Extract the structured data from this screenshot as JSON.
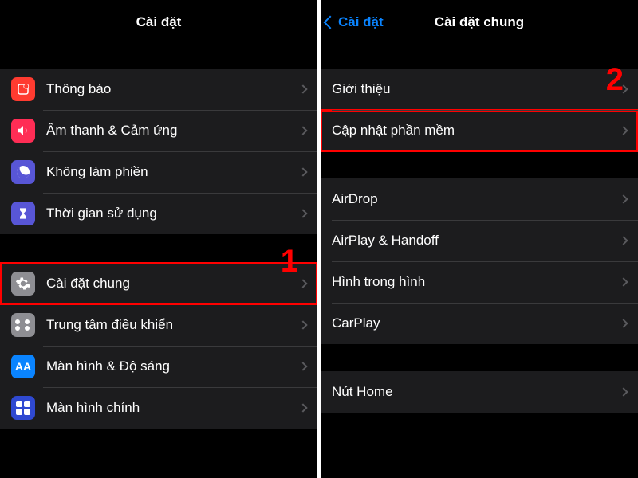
{
  "left": {
    "title": "Cài đặt",
    "step_number": "1",
    "sections": [
      {
        "rows": [
          {
            "icon": "notif",
            "label": "Thông báo"
          },
          {
            "icon": "sound",
            "label": "Âm thanh & Cảm ứng"
          },
          {
            "icon": "dnd",
            "label": "Không làm phiền"
          },
          {
            "icon": "time",
            "label": "Thời gian sử dụng"
          }
        ]
      },
      {
        "rows": [
          {
            "icon": "general",
            "label": "Cài đặt chung",
            "highlight": true
          },
          {
            "icon": "control",
            "label": "Trung tâm điều khiển"
          },
          {
            "icon": "display",
            "label": "Màn hình & Độ sáng"
          },
          {
            "icon": "home",
            "label": "Màn hình chính"
          }
        ]
      }
    ]
  },
  "right": {
    "back_label": "Cài đặt",
    "title": "Cài đặt chung",
    "step_number": "2",
    "sections": [
      {
        "rows": [
          {
            "label": "Giới thiệu"
          },
          {
            "label": "Cập nhật phần mềm",
            "highlight": true
          }
        ]
      },
      {
        "rows": [
          {
            "label": "AirDrop"
          },
          {
            "label": "AirPlay & Handoff"
          },
          {
            "label": "Hình trong hình"
          },
          {
            "label": "CarPlay"
          }
        ]
      },
      {
        "rows": [
          {
            "label": "Nút Home"
          }
        ]
      }
    ]
  }
}
